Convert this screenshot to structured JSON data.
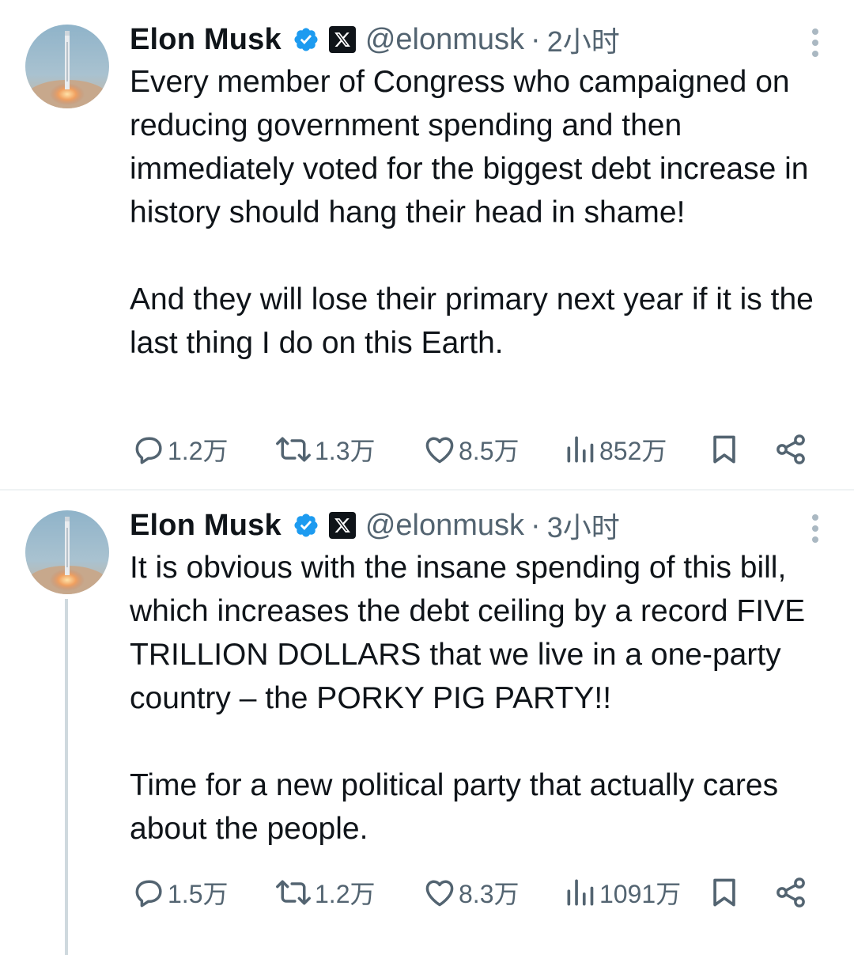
{
  "tweets": [
    {
      "author": {
        "name": "Elon Musk",
        "handle": "@elonmusk"
      },
      "separator": "·",
      "time": "2小时",
      "paragraphs": [
        "Every member of Congress who campaigned on reducing government spending and then immediately voted for the biggest debt increase in history should hang their head in shame!",
        "And they will lose their primary next year if it is the last thing I do on this Earth."
      ],
      "stats": {
        "replies": "1.2万",
        "retweets": "1.3万",
        "likes": "8.5万",
        "views": "852万"
      }
    },
    {
      "author": {
        "name": "Elon Musk",
        "handle": "@elonmusk"
      },
      "separator": "·",
      "time": "3小时",
      "paragraphs": [
        "It is obvious with the insane spending of this bill, which increases the debt ceiling by a record FIVE TRILLION DOLLARS that we live in a one-party country – the PORKY PIG PARTY!!",
        "Time for a new political party that actually cares about the people."
      ],
      "stats": {
        "replies": "1.5万",
        "retweets": "1.2万",
        "likes": "8.3万",
        "views": "1091万"
      }
    }
  ],
  "colors": {
    "text": "#0f1419",
    "secondary": "#536471",
    "verified": "#1d9bf0",
    "divider": "#eff3f4"
  },
  "icons": [
    "verified-badge-icon",
    "x-logo-icon",
    "more-icon",
    "reply-icon",
    "retweet-icon",
    "like-icon",
    "views-icon",
    "bookmark-icon",
    "share-icon"
  ]
}
